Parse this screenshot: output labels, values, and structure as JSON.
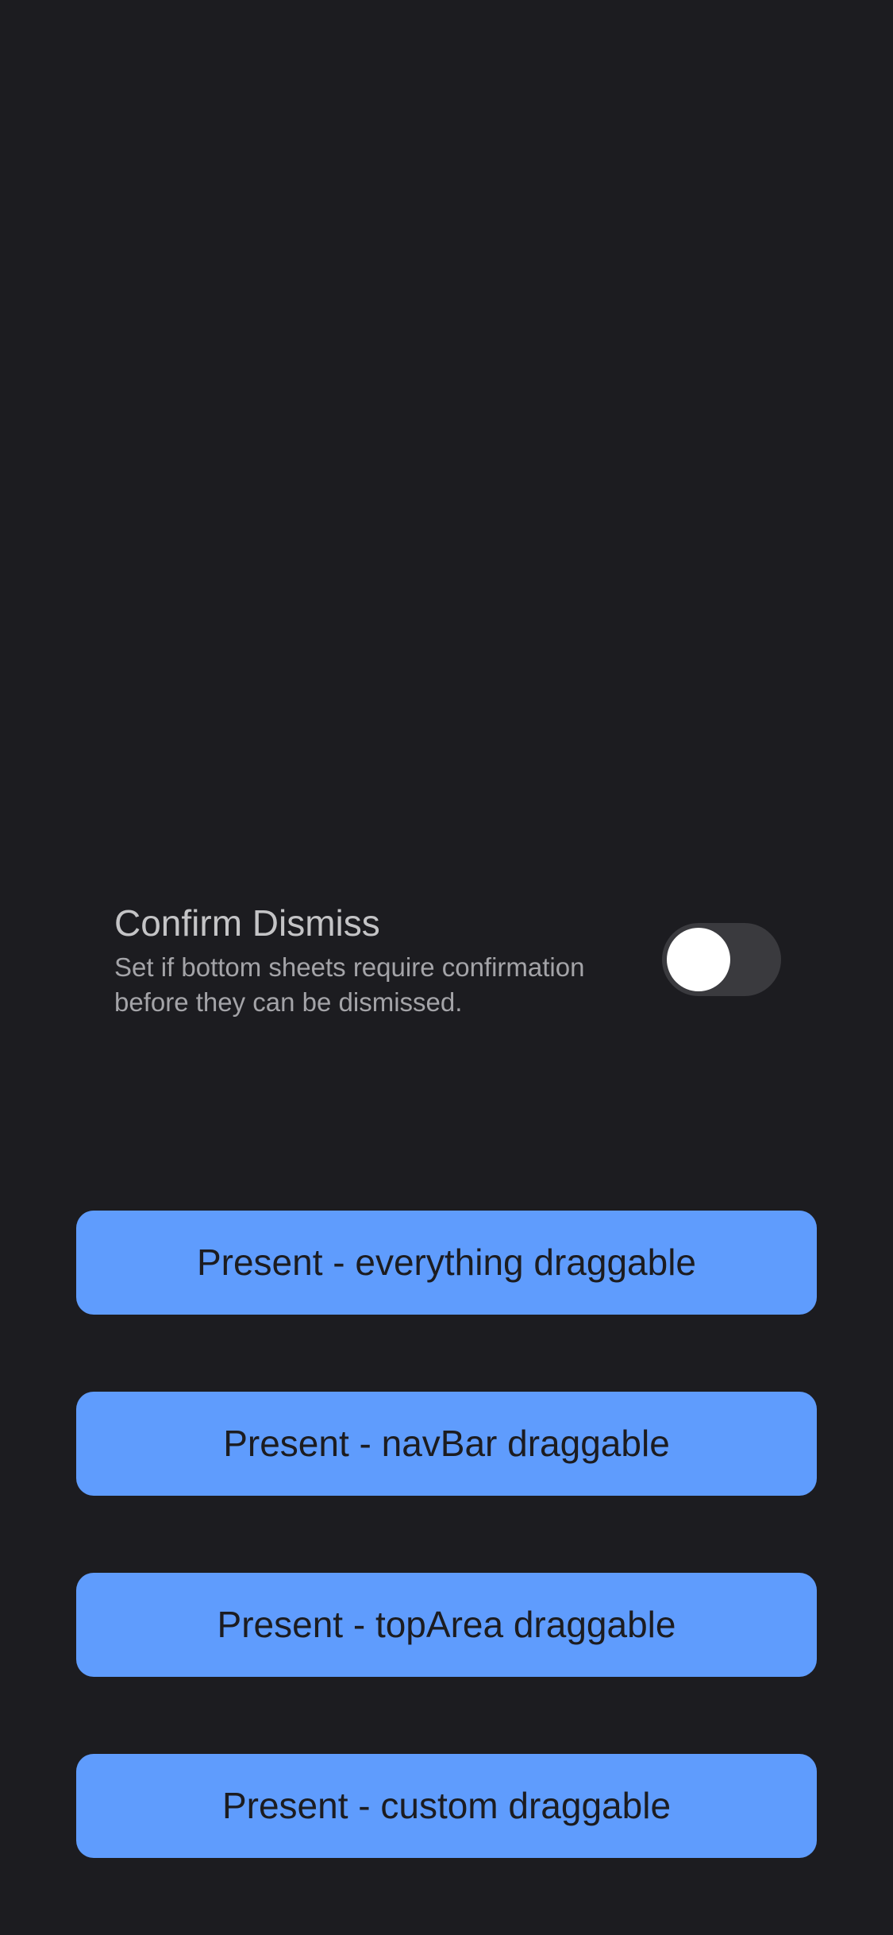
{
  "setting": {
    "title": "Confirm Dismiss",
    "description": "Set if bottom sheets require confirmation before they can be dismissed.",
    "toggle_on": false
  },
  "buttons": [
    {
      "label": "Present - everything draggable"
    },
    {
      "label": "Present - navBar draggable"
    },
    {
      "label": "Present - topArea draggable"
    },
    {
      "label": "Present - custom draggable"
    }
  ],
  "colors": {
    "background": "#1c1c20",
    "button": "#5f9cfd",
    "toggle_track_off": "#3a3a3e",
    "toggle_knob": "#ffffff"
  }
}
